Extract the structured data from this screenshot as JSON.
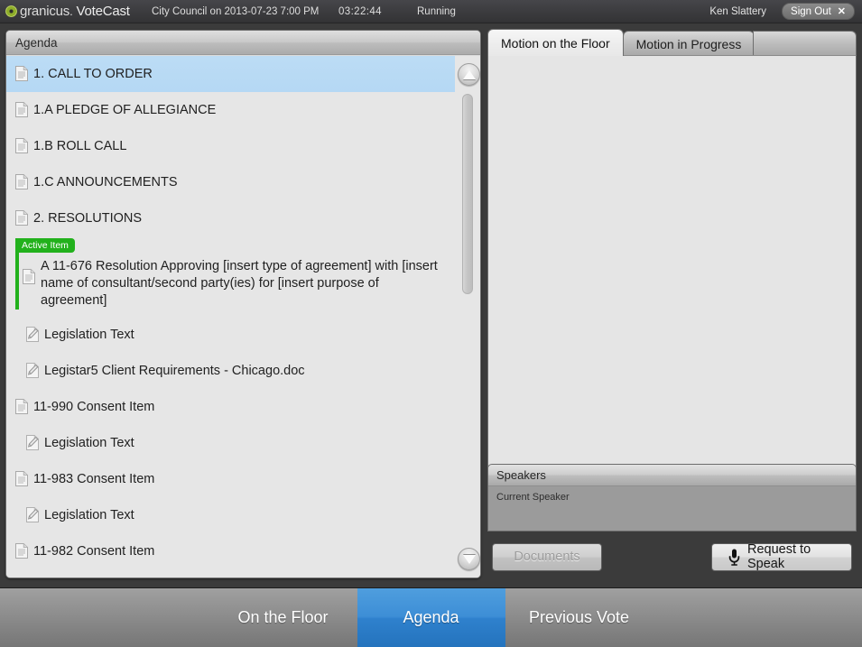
{
  "header": {
    "brand_prefix": "granicus",
    "brand_suffix": "VoteCast",
    "meeting_title": "City Council on 2013-07-23 7:00 PM",
    "clock": "03:22:44",
    "status": "Running",
    "user_name": "Ken Slattery",
    "sign_out_label": "Sign Out",
    "sign_out_icon_glyph": "✕",
    "logo_icon": "granicus-circle-logo"
  },
  "agenda": {
    "panel_title": "Agenda",
    "active_badge_label": "Active Item",
    "items": [
      {
        "label": "1.  CALL TO ORDER",
        "type": "agenda",
        "selected": true,
        "indent": false
      },
      {
        "label": "1.A  PLEDGE OF ALLEGIANCE",
        "type": "agenda",
        "selected": false,
        "indent": false
      },
      {
        "label": "1.B  ROLL CALL",
        "type": "agenda",
        "selected": false,
        "indent": false
      },
      {
        "label": "1.C  ANNOUNCEMENTS",
        "type": "agenda",
        "selected": false,
        "indent": false
      },
      {
        "label": "2.  RESOLUTIONS",
        "type": "agenda",
        "selected": false,
        "indent": false
      }
    ],
    "active_item": {
      "text": "A 11-676 Resolution Approving [insert type of agreement] with [insert name of consultant/second party(ies) for [insert purpose of agreement]"
    },
    "items_after": [
      {
        "label": "Legislation Text",
        "type": "attachment",
        "selected": false,
        "indent": true
      },
      {
        "label": "Legistar5 Client Requirements - Chicago.doc",
        "type": "attachment",
        "selected": false,
        "indent": true
      },
      {
        "label": "11-990 Consent Item",
        "type": "agenda",
        "selected": false,
        "indent": false
      },
      {
        "label": "Legislation Text",
        "type": "attachment",
        "selected": false,
        "indent": true
      },
      {
        "label": "11-983 Consent Item",
        "type": "agenda",
        "selected": false,
        "indent": false
      },
      {
        "label": "Legislation Text",
        "type": "attachment",
        "selected": false,
        "indent": true
      },
      {
        "label": "11-982 Consent Item",
        "type": "agenda",
        "selected": false,
        "indent": false
      }
    ],
    "scroll_up_icon": "triangle-up-icon",
    "scroll_down_icon": "triangle-down-icon"
  },
  "motion": {
    "tabs": [
      {
        "label": "Motion on the Floor",
        "active": true
      },
      {
        "label": "Motion in Progress",
        "active": false
      }
    ],
    "content": ""
  },
  "speakers": {
    "panel_title": "Speakers",
    "current_speaker_label": "Current Speaker"
  },
  "actions": {
    "documents_label": "Documents",
    "request_to_speak_label": "Request to Speak",
    "mic_icon": "microphone-icon"
  },
  "bottom_nav": {
    "items": [
      {
        "label": "On the Floor",
        "active": false
      },
      {
        "label": "Agenda",
        "active": true
      },
      {
        "label": "Previous Vote",
        "active": false
      }
    ]
  },
  "colors": {
    "accent_blue": "#3d8ed6",
    "active_green": "#22b11c",
    "selection_blue": "#b5d8f4",
    "panel_gray": "#e6e6e6",
    "chrome_dark": "#3b3b3b"
  }
}
